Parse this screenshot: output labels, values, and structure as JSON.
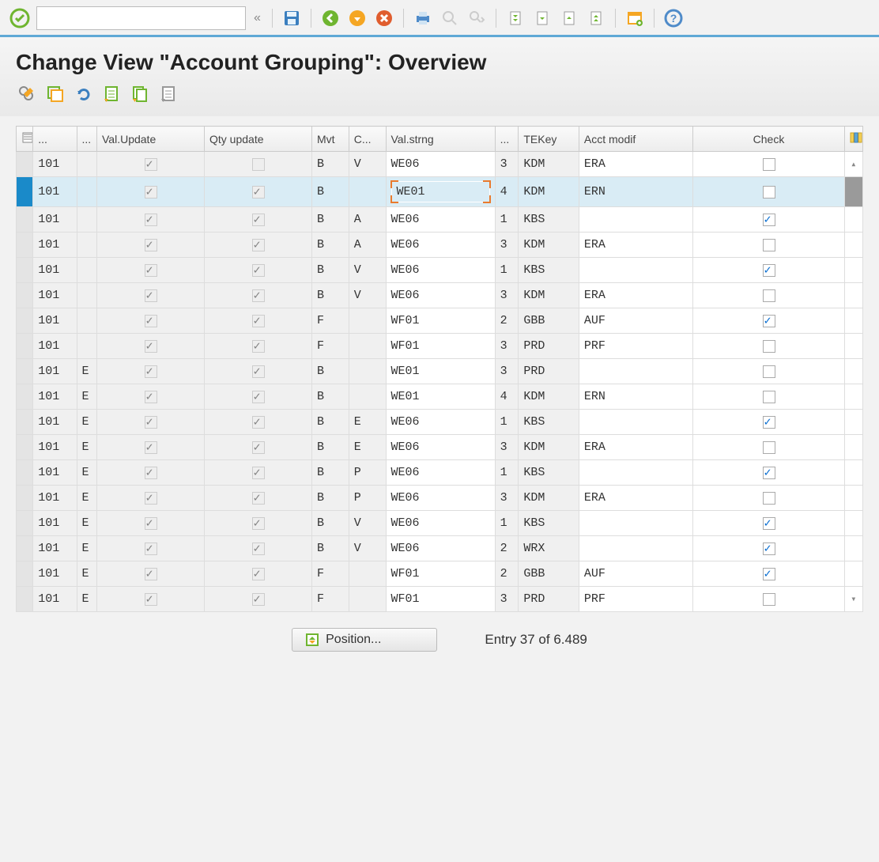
{
  "title": "Change View \"Account Grouping\": Overview",
  "columns": {
    "code": "...",
    "sp": "...",
    "valUpdate": "Val.Update",
    "qtyUpdate": "Qty update",
    "mvt": "Mvt",
    "cns": "C...",
    "valStrng": "Val.strng",
    "cnt": "...",
    "teKey": "TEKey",
    "acctModif": "Acct modif",
    "check": "Check"
  },
  "footer": {
    "positionLabel": "Position...",
    "entryText": "Entry 37 of 6.489"
  },
  "rows": [
    {
      "code": "101",
      "sp": "",
      "val": true,
      "qty": false,
      "mvt": "B",
      "cns": "V",
      "vstr": "WE06",
      "cnt": "3",
      "tek": "KDM",
      "am": "ERA",
      "chk": false,
      "sel": false,
      "focus": false
    },
    {
      "code": "101",
      "sp": "",
      "val": true,
      "qty": true,
      "mvt": "B",
      "cns": "",
      "vstr": "WE01",
      "cnt": "4",
      "tek": "KDM",
      "am": "ERN",
      "chk": false,
      "sel": true,
      "focus": true
    },
    {
      "code": "101",
      "sp": "",
      "val": true,
      "qty": true,
      "mvt": "B",
      "cns": "A",
      "vstr": "WE06",
      "cnt": "1",
      "tek": "KBS",
      "am": "",
      "chk": true,
      "sel": false,
      "focus": false
    },
    {
      "code": "101",
      "sp": "",
      "val": true,
      "qty": true,
      "mvt": "B",
      "cns": "A",
      "vstr": "WE06",
      "cnt": "3",
      "tek": "KDM",
      "am": "ERA",
      "chk": false,
      "sel": false,
      "focus": false
    },
    {
      "code": "101",
      "sp": "",
      "val": true,
      "qty": true,
      "mvt": "B",
      "cns": "V",
      "vstr": "WE06",
      "cnt": "1",
      "tek": "KBS",
      "am": "",
      "chk": true,
      "sel": false,
      "focus": false
    },
    {
      "code": "101",
      "sp": "",
      "val": true,
      "qty": true,
      "mvt": "B",
      "cns": "V",
      "vstr": "WE06",
      "cnt": "3",
      "tek": "KDM",
      "am": "ERA",
      "chk": false,
      "sel": false,
      "focus": false
    },
    {
      "code": "101",
      "sp": "",
      "val": true,
      "qty": true,
      "mvt": "F",
      "cns": "",
      "vstr": "WF01",
      "cnt": "2",
      "tek": "GBB",
      "am": "AUF",
      "chk": true,
      "sel": false,
      "focus": false
    },
    {
      "code": "101",
      "sp": "",
      "val": true,
      "qty": true,
      "mvt": "F",
      "cns": "",
      "vstr": "WF01",
      "cnt": "3",
      "tek": "PRD",
      "am": "PRF",
      "chk": false,
      "sel": false,
      "focus": false
    },
    {
      "code": "101",
      "sp": "E",
      "val": true,
      "qty": true,
      "mvt": "B",
      "cns": "",
      "vstr": "WE01",
      "cnt": "3",
      "tek": "PRD",
      "am": "",
      "chk": false,
      "sel": false,
      "focus": false
    },
    {
      "code": "101",
      "sp": "E",
      "val": true,
      "qty": true,
      "mvt": "B",
      "cns": "",
      "vstr": "WE01",
      "cnt": "4",
      "tek": "KDM",
      "am": "ERN",
      "chk": false,
      "sel": false,
      "focus": false
    },
    {
      "code": "101",
      "sp": "E",
      "val": true,
      "qty": true,
      "mvt": "B",
      "cns": "E",
      "vstr": "WE06",
      "cnt": "1",
      "tek": "KBS",
      "am": "",
      "chk": true,
      "sel": false,
      "focus": false
    },
    {
      "code": "101",
      "sp": "E",
      "val": true,
      "qty": true,
      "mvt": "B",
      "cns": "E",
      "vstr": "WE06",
      "cnt": "3",
      "tek": "KDM",
      "am": "ERA",
      "chk": false,
      "sel": false,
      "focus": false
    },
    {
      "code": "101",
      "sp": "E",
      "val": true,
      "qty": true,
      "mvt": "B",
      "cns": "P",
      "vstr": "WE06",
      "cnt": "1",
      "tek": "KBS",
      "am": "",
      "chk": true,
      "sel": false,
      "focus": false
    },
    {
      "code": "101",
      "sp": "E",
      "val": true,
      "qty": true,
      "mvt": "B",
      "cns": "P",
      "vstr": "WE06",
      "cnt": "3",
      "tek": "KDM",
      "am": "ERA",
      "chk": false,
      "sel": false,
      "focus": false
    },
    {
      "code": "101",
      "sp": "E",
      "val": true,
      "qty": true,
      "mvt": "B",
      "cns": "V",
      "vstr": "WE06",
      "cnt": "1",
      "tek": "KBS",
      "am": "",
      "chk": true,
      "sel": false,
      "focus": false
    },
    {
      "code": "101",
      "sp": "E",
      "val": true,
      "qty": true,
      "mvt": "B",
      "cns": "V",
      "vstr": "WE06",
      "cnt": "2",
      "tek": "WRX",
      "am": "",
      "chk": true,
      "sel": false,
      "focus": false
    },
    {
      "code": "101",
      "sp": "E",
      "val": true,
      "qty": true,
      "mvt": "F",
      "cns": "",
      "vstr": "WF01",
      "cnt": "2",
      "tek": "GBB",
      "am": "AUF",
      "chk": true,
      "sel": false,
      "focus": false
    },
    {
      "code": "101",
      "sp": "E",
      "val": true,
      "qty": true,
      "mvt": "F",
      "cns": "",
      "vstr": "WF01",
      "cnt": "3",
      "tek": "PRD",
      "am": "PRF",
      "chk": false,
      "sel": false,
      "focus": false
    }
  ]
}
